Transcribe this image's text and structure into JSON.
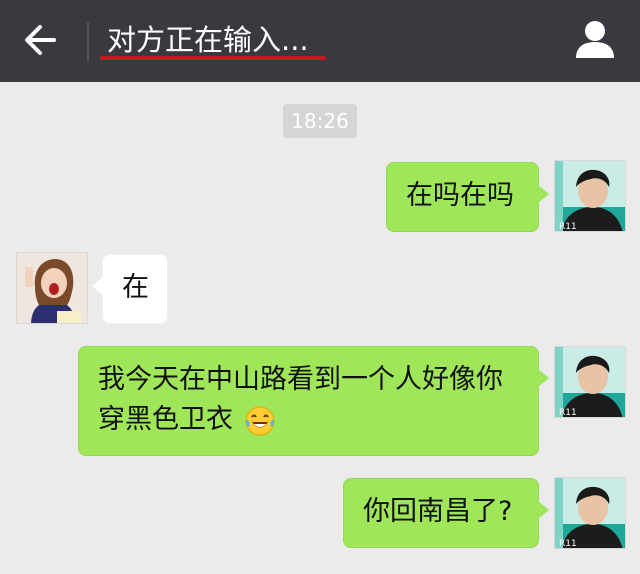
{
  "header": {
    "title": "对方正在输入...",
    "back_icon": "arrow-left-icon",
    "profile_icon": "person-icon",
    "underline_color": "#c8181e"
  },
  "chat": {
    "timestamp": "18:26",
    "messages": [
      {
        "sender": "me",
        "text": "在吗在吗"
      },
      {
        "sender": "them",
        "text": "在"
      },
      {
        "sender": "me",
        "line1": "我今天在中山路看到一个人好像你",
        "line2": "穿黑色卫衣",
        "emoji": "laughing-tears-emoji"
      },
      {
        "sender": "me",
        "text": "你回南昌了?"
      }
    ]
  },
  "avatars": {
    "me_badge": "R11",
    "them": "girl-photo"
  },
  "colors": {
    "header_bg": "#393a3f",
    "chat_bg": "#ebebeb",
    "my_bubble": "#9fe658",
    "their_bubble": "#ffffff"
  }
}
